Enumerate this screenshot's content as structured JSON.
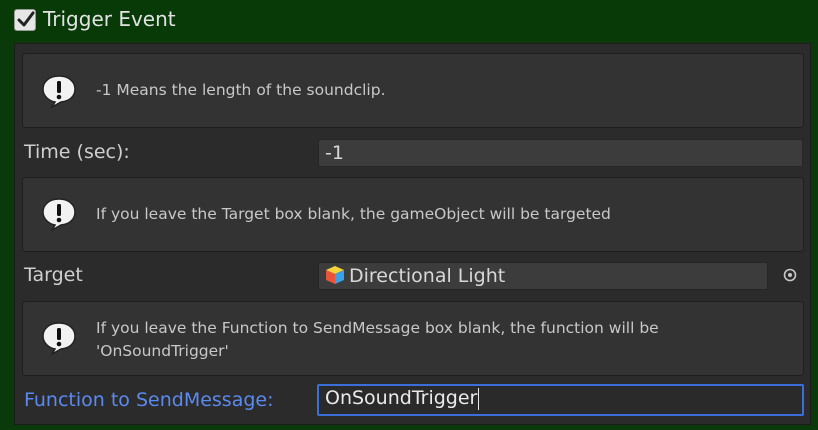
{
  "header": {
    "title": "Trigger Event",
    "enabled": true
  },
  "help_boxes": [
    {
      "text": "-1 Means the length of the soundclip.",
      "icon": "info-icon"
    },
    {
      "text": "If you leave the Target box blank, the gameObject will be targeted",
      "icon": "info-icon"
    },
    {
      "text": "If you leave the Function to SendMessage box blank, the function will be 'OnSoundTrigger'",
      "icon": "info-icon"
    }
  ],
  "fields": {
    "time": {
      "label": "Time (sec):",
      "value": "-1"
    },
    "target": {
      "label": "Target",
      "value": "Directional Light",
      "icon": "gameobject-cube-icon"
    },
    "function": {
      "label": "Function to SendMessage:",
      "value": "OnSoundTrigger"
    }
  },
  "colors": {
    "header_bg": "#073a07",
    "panel_bg": "#2b2b2b",
    "focus_accent": "#3a6fd8",
    "focus_label": "#5b8af0"
  }
}
